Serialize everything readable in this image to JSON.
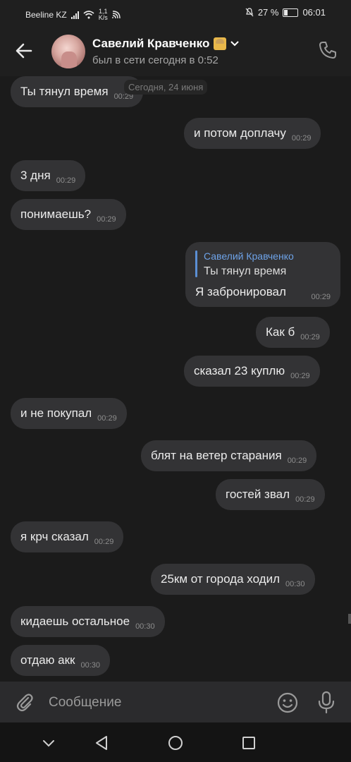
{
  "status_bar": {
    "carrier": "Beeline KZ",
    "speed_value": "1,1",
    "speed_unit": "K/s",
    "battery": "27 %",
    "time": "06:01"
  },
  "header": {
    "contact_name": "Савелий Кравченко",
    "last_seen": "был в сети сегодня в 0:52"
  },
  "date_separator": "Сегодня, 24 июня",
  "messages": [
    {
      "text": "Ты тянул время",
      "time": "00:29",
      "side": "in"
    },
    {
      "text": "и потом доплачу",
      "time": "00:29",
      "side": "out"
    },
    {
      "text": "3 дня",
      "time": "00:29",
      "side": "in"
    },
    {
      "text": "понимаешь?",
      "time": "00:29",
      "side": "in"
    },
    {
      "text": "Как б",
      "time": "00:29",
      "side": "out"
    },
    {
      "text": "сказал 23 куплю",
      "time": "00:29",
      "side": "out"
    },
    {
      "text": "и не покупал",
      "time": "00:29",
      "side": "in"
    },
    {
      "text": "блят на ветер старания",
      "time": "00:29",
      "side": "out"
    },
    {
      "text": "гостей звал",
      "time": "00:29",
      "side": "out"
    },
    {
      "text": "я крч сказал",
      "time": "00:29",
      "side": "in"
    },
    {
      "text": "25км от города ходил",
      "time": "00:30",
      "side": "out"
    },
    {
      "text": "кидаешь остальное",
      "time": "00:30",
      "side": "in"
    },
    {
      "text": "отдаю акк",
      "time": "00:30",
      "side": "in"
    }
  ],
  "reply_message": {
    "quoted_name": "Савелий Кравченко",
    "quoted_text": "Ты тянул время",
    "text": "Я забронировал",
    "time": "00:29",
    "side": "out"
  },
  "composer": {
    "placeholder": "Сообщение"
  },
  "icons": {
    "back": "back-arrow-icon",
    "call": "phone-icon",
    "attach": "paperclip-icon",
    "emoji": "smiley-icon",
    "voice": "microphone-icon",
    "nav_menu": "chevron-down-icon",
    "nav_back": "triangle-back-icon",
    "nav_home": "circle-home-icon",
    "nav_recent": "square-recents-icon"
  },
  "colors": {
    "bubble": "#333335",
    "background": "#1b1b1b",
    "accent_blue": "#6ea3e8"
  }
}
